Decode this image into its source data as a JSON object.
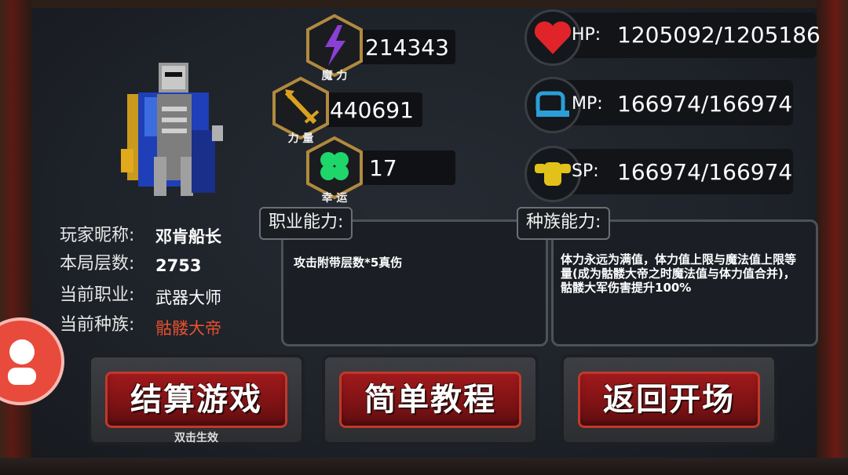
{
  "stats": {
    "magic": {
      "caption": "魔 力",
      "value": "214343",
      "icon": "lightning-icon",
      "color": "#8a3fd6"
    },
    "power": {
      "caption": "力 量",
      "value": "440691",
      "icon": "sword-icon",
      "color": "#d8a21e"
    },
    "luck": {
      "caption": "幸 运",
      "value": "17",
      "icon": "clover-icon",
      "color": "#1fd66b"
    }
  },
  "resources": {
    "hp": {
      "label": "HP:",
      "value": "1205092/1205186",
      "icon": "heart-icon",
      "color": "#e0242a"
    },
    "mp": {
      "label": "MP:",
      "value": "166974/166974",
      "icon": "mana-icon",
      "color": "#2a9fd8"
    },
    "sp": {
      "label": "SP:",
      "value": "166974/166974",
      "icon": "muscle-icon",
      "color": "#e2c21a"
    }
  },
  "player": {
    "nickname_label": "玩家昵称:",
    "nickname": "邓肯船长",
    "floor_label": "本局层数:",
    "floor": "2753",
    "job_label": "当前职业:",
    "job": "武器大师",
    "race_label": "当前种族:",
    "race": "骷髅大帝"
  },
  "abilities": {
    "job_title": "职业能力:",
    "job_desc": "攻击附带层数*5真伤",
    "race_title": "种族能力:",
    "race_desc": "体力永远为满值，体力值上限与魔法值上限等量(成为骷髅大帝之时魔法值与体力值合并)，骷髅大军伤害提升100%"
  },
  "buttons": {
    "settle": "结算游戏",
    "settle_hint": "双击生效",
    "tutorial": "简单教程",
    "back": "返回开场"
  }
}
